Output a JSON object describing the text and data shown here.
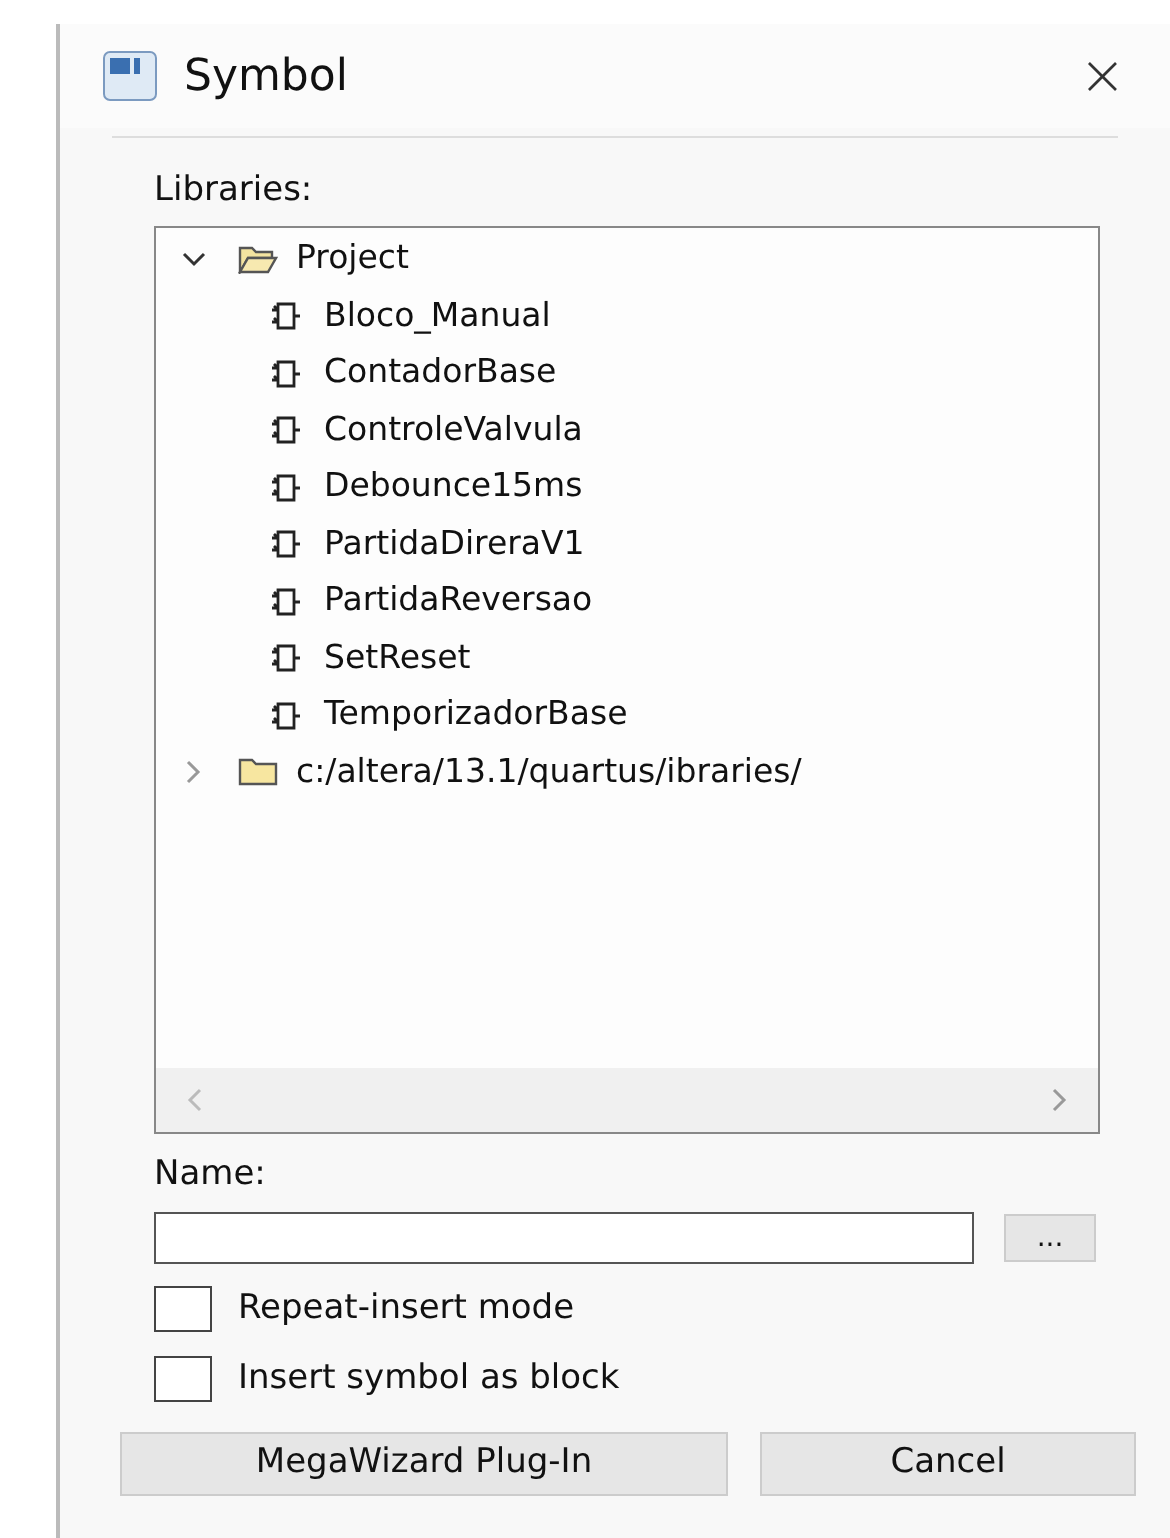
{
  "window": {
    "title": "Symbol",
    "close": "×"
  },
  "libraries": {
    "label": "Libraries:",
    "tree": [
      {
        "label": "Project",
        "kind": "folder",
        "expanded": true,
        "children": [
          {
            "label": "Bloco_Manual",
            "kind": "symbol"
          },
          {
            "label": "ContadorBase",
            "kind": "symbol"
          },
          {
            "label": "ControleValvula",
            "kind": "symbol"
          },
          {
            "label": "Debounce15ms",
            "kind": "symbol"
          },
          {
            "label": "PartidaDireraV1",
            "kind": "symbol"
          },
          {
            "label": "PartidaReversao",
            "kind": "symbol"
          },
          {
            "label": "SetReset",
            "kind": "symbol"
          },
          {
            "label": "TemporizadorBase",
            "kind": "symbol"
          }
        ]
      },
      {
        "label": "c:/altera/13.1/quartus/ibraries/",
        "kind": "folder",
        "expanded": false
      }
    ]
  },
  "name": {
    "label": "Name:",
    "browse": "..."
  },
  "options": [
    {
      "label": "Repeat-insert mode",
      "checked": false
    },
    {
      "label": "Insert symbol as block",
      "checked": false
    }
  ],
  "buttons": [
    "MegaWizard Plug-In",
    "Cancel"
  ]
}
